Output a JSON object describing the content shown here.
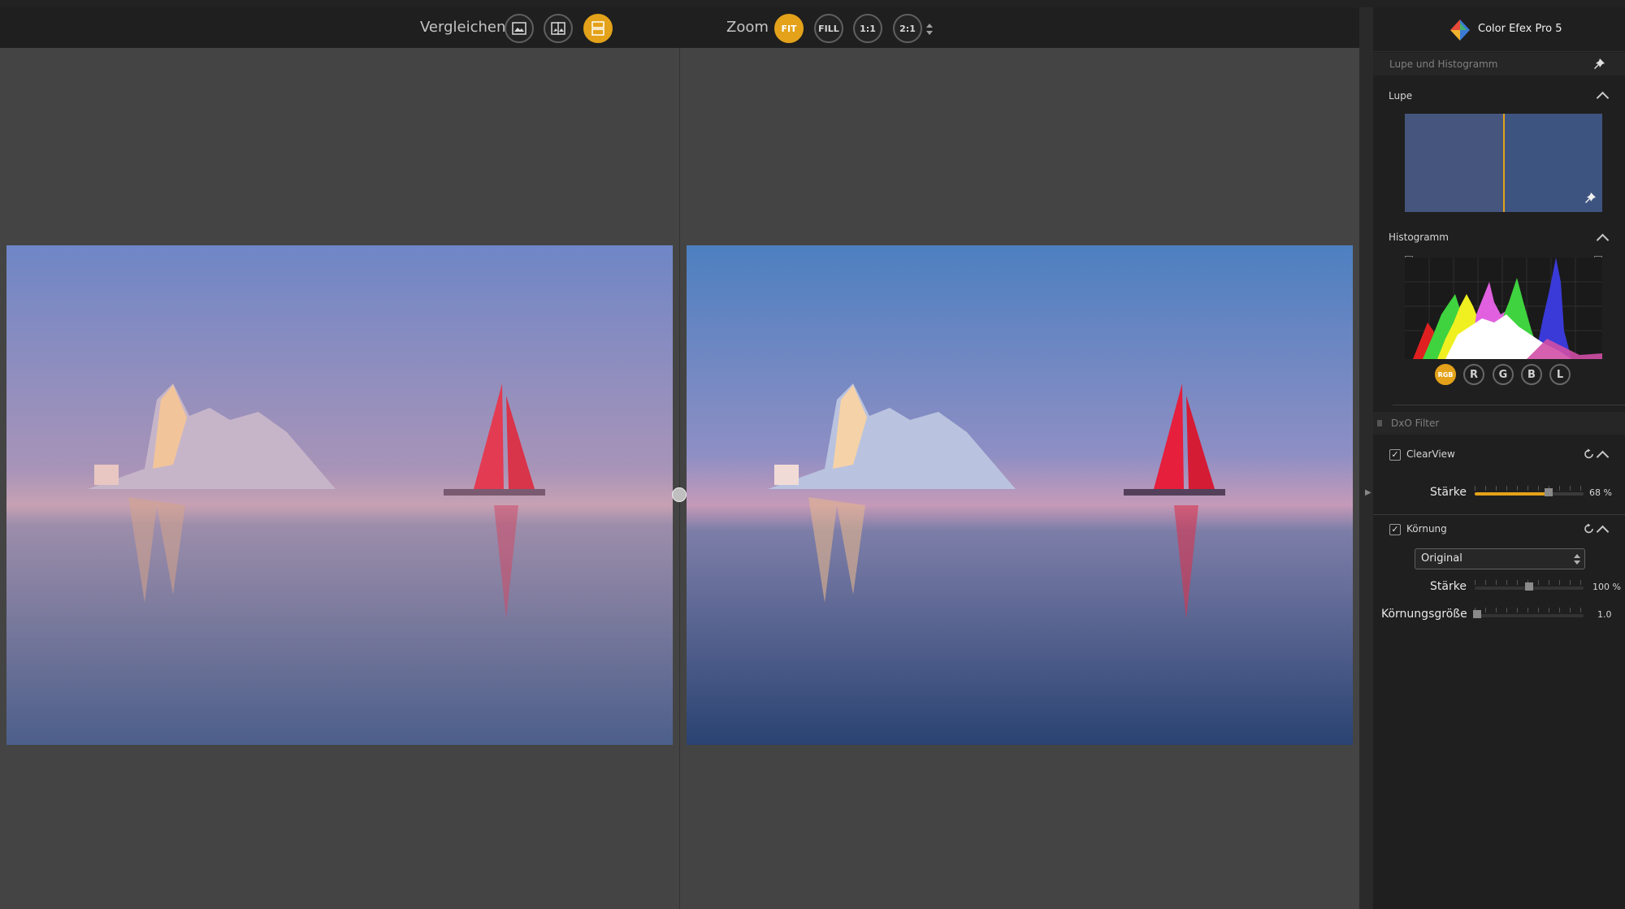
{
  "toolbar": {
    "compare_label": "Vergleichen",
    "zoom_label": "Zoom",
    "zoom_buttons": [
      "FIT",
      "FILL",
      "1:1",
      "2:1"
    ]
  },
  "panel": {
    "app_title": "Color Efex Pro 5",
    "loupe_histogram_header": "Lupe und Histogramm",
    "loupe_label": "Lupe",
    "histogram_label": "Histogramm",
    "histogram_channels": [
      "RGB",
      "R",
      "G",
      "B",
      "L"
    ],
    "filter_header": "DxO Filter",
    "clearview": {
      "title": "ClearView",
      "strength_label": "Stärke",
      "strength_value": "68 %",
      "strength_fraction": 0.68
    },
    "grain": {
      "title": "Körnung",
      "preset": "Original",
      "strength_label": "Stärke",
      "strength_value": "100 %",
      "strength_fraction": 0.5,
      "size_label": "Körnungsgröße",
      "size_value": "1.0",
      "size_fraction": 0.0
    }
  },
  "colors": {
    "accent": "#e3a21a",
    "panel_bg": "#1f1f1f",
    "canvas_bg": "#444444"
  }
}
